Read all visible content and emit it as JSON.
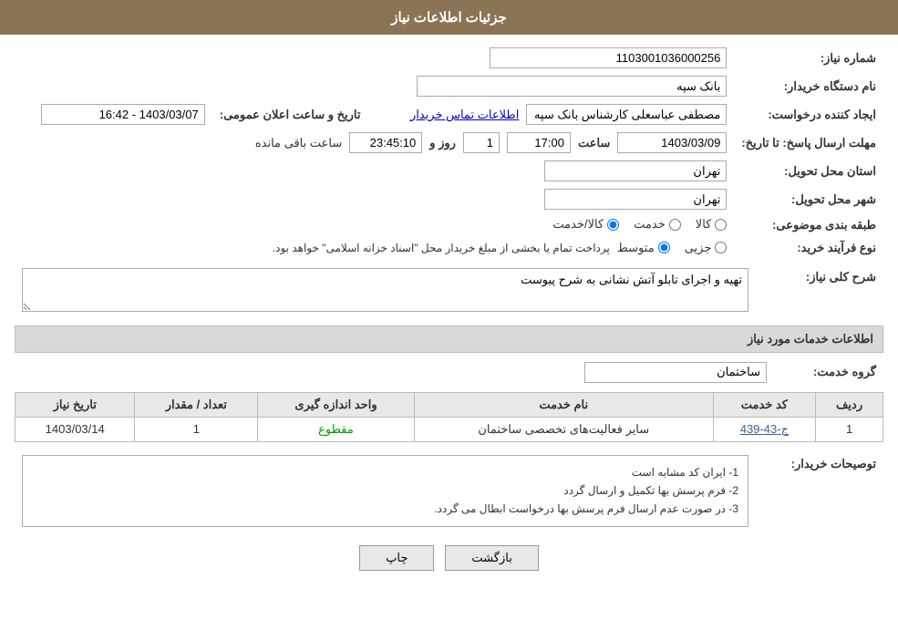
{
  "header": {
    "title": "جزئیات اطلاعات نیاز"
  },
  "need_info": {
    "need_number_label": "شماره نیاز:",
    "need_number_value": "1103001036000256",
    "org_label": "نام دستگاه خریدار:",
    "org_value": "بانک سپه",
    "creator_label": "ایجاد کننده درخواست:",
    "creator_value": "مصطفی عباسعلی کارشناس بانک سپه",
    "contact_link": "اطلاعات تماس خریدار",
    "announce_label": "تاریخ و ساعت اعلان عمومی:",
    "announce_value": "1403/03/07 - 16:42",
    "deadline_label": "مهلت ارسال پاسخ: تا تاریخ:",
    "deadline_date": "1403/03/09",
    "deadline_time_label": "ساعت",
    "deadline_time": "17:00",
    "deadline_days_label": "روز و",
    "deadline_days": "1",
    "deadline_remaining": "23:45:10",
    "deadline_remaining_label": "ساعت باقی مانده",
    "province_label": "استان محل تحویل:",
    "province_value": "تهران",
    "city_label": "شهر محل تحویل:",
    "city_value": "تهران",
    "category_label": "طبقه بندی موضوعی:",
    "category_kala": "کالا",
    "category_khedmat": "خدمت",
    "category_kala_khedmat": "کالا/خدمت",
    "purchase_label": "نوع فرآیند خرید:",
    "purchase_jozei": "جزیی",
    "purchase_motawaset": "متوسط",
    "purchase_note": "پرداخت تمام یا بخشی از مبلغ خریدار محل \"اسناد خزانه اسلامی\" خواهد بود."
  },
  "description": {
    "section_title": "شرح کلی نیاز:",
    "value": "تهیه و اجرای تابلو آتش نشانی به شرح پیوست"
  },
  "services": {
    "section_title": "اطلاعات خدمات مورد نیاز",
    "group_label": "گروه خدمت:",
    "group_value": "ساختمان",
    "table_headers": {
      "row_num": "ردیف",
      "service_code": "کد خدمت",
      "service_name": "نام خدمت",
      "unit": "واحد اندازه گیری",
      "qty": "تعداد / مقدار",
      "date": "تاریخ نیاز"
    },
    "rows": [
      {
        "row_num": "1",
        "service_code": "ج-43-439",
        "service_name": "سایر فعالیت‌های تخصصی ساختمان",
        "unit": "مقطوع",
        "qty": "1",
        "date": "1403/03/14"
      }
    ]
  },
  "buyer_notes": {
    "section_title": "توصیحات خریدار:",
    "lines": [
      "1- ایران کد مشابه است",
      "2- فرم پرسش بها تکمیل و ارسال گردد",
      "3- در صورت عدم ارسال فرم پرسش بها درخواست ابطال می گردد."
    ]
  },
  "buttons": {
    "print_label": "چاپ",
    "back_label": "بازگشت"
  }
}
